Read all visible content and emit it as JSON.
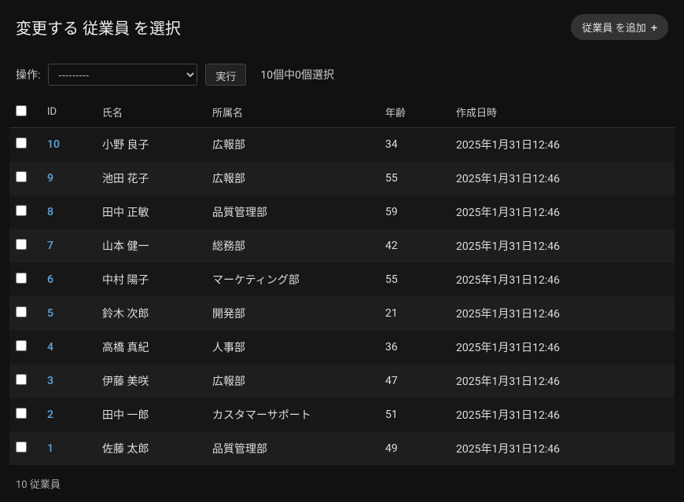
{
  "header": {
    "title": "変更する 従業員 を選択",
    "add_button": "従業員 を追加"
  },
  "actions": {
    "label": "操作:",
    "placeholder": "---------",
    "go": "実行",
    "counter": "10個中0個選択"
  },
  "columns": {
    "id": "ID",
    "name": "氏名",
    "dept": "所属名",
    "age": "年齢",
    "created": "作成日時"
  },
  "rows": [
    {
      "id": "10",
      "name": "小野 良子",
      "dept": "広報部",
      "age": "34",
      "created": "2025年1月31日12:46"
    },
    {
      "id": "9",
      "name": "池田 花子",
      "dept": "広報部",
      "age": "55",
      "created": "2025年1月31日12:46"
    },
    {
      "id": "8",
      "name": "田中 正敏",
      "dept": "品質管理部",
      "age": "59",
      "created": "2025年1月31日12:46"
    },
    {
      "id": "7",
      "name": "山本 健一",
      "dept": "総務部",
      "age": "42",
      "created": "2025年1月31日12:46"
    },
    {
      "id": "6",
      "name": "中村 陽子",
      "dept": "マーケティング部",
      "age": "55",
      "created": "2025年1月31日12:46"
    },
    {
      "id": "5",
      "name": "鈴木 次郎",
      "dept": "開発部",
      "age": "21",
      "created": "2025年1月31日12:46"
    },
    {
      "id": "4",
      "name": "高橋 真紀",
      "dept": "人事部",
      "age": "36",
      "created": "2025年1月31日12:46"
    },
    {
      "id": "3",
      "name": "伊藤 美咲",
      "dept": "広報部",
      "age": "47",
      "created": "2025年1月31日12:46"
    },
    {
      "id": "2",
      "name": "田中 一郎",
      "dept": "カスタマーサポート",
      "age": "51",
      "created": "2025年1月31日12:46"
    },
    {
      "id": "1",
      "name": "佐藤 太郎",
      "dept": "品質管理部",
      "age": "49",
      "created": "2025年1月31日12:46"
    }
  ],
  "footer": {
    "count": "10 従業員"
  }
}
